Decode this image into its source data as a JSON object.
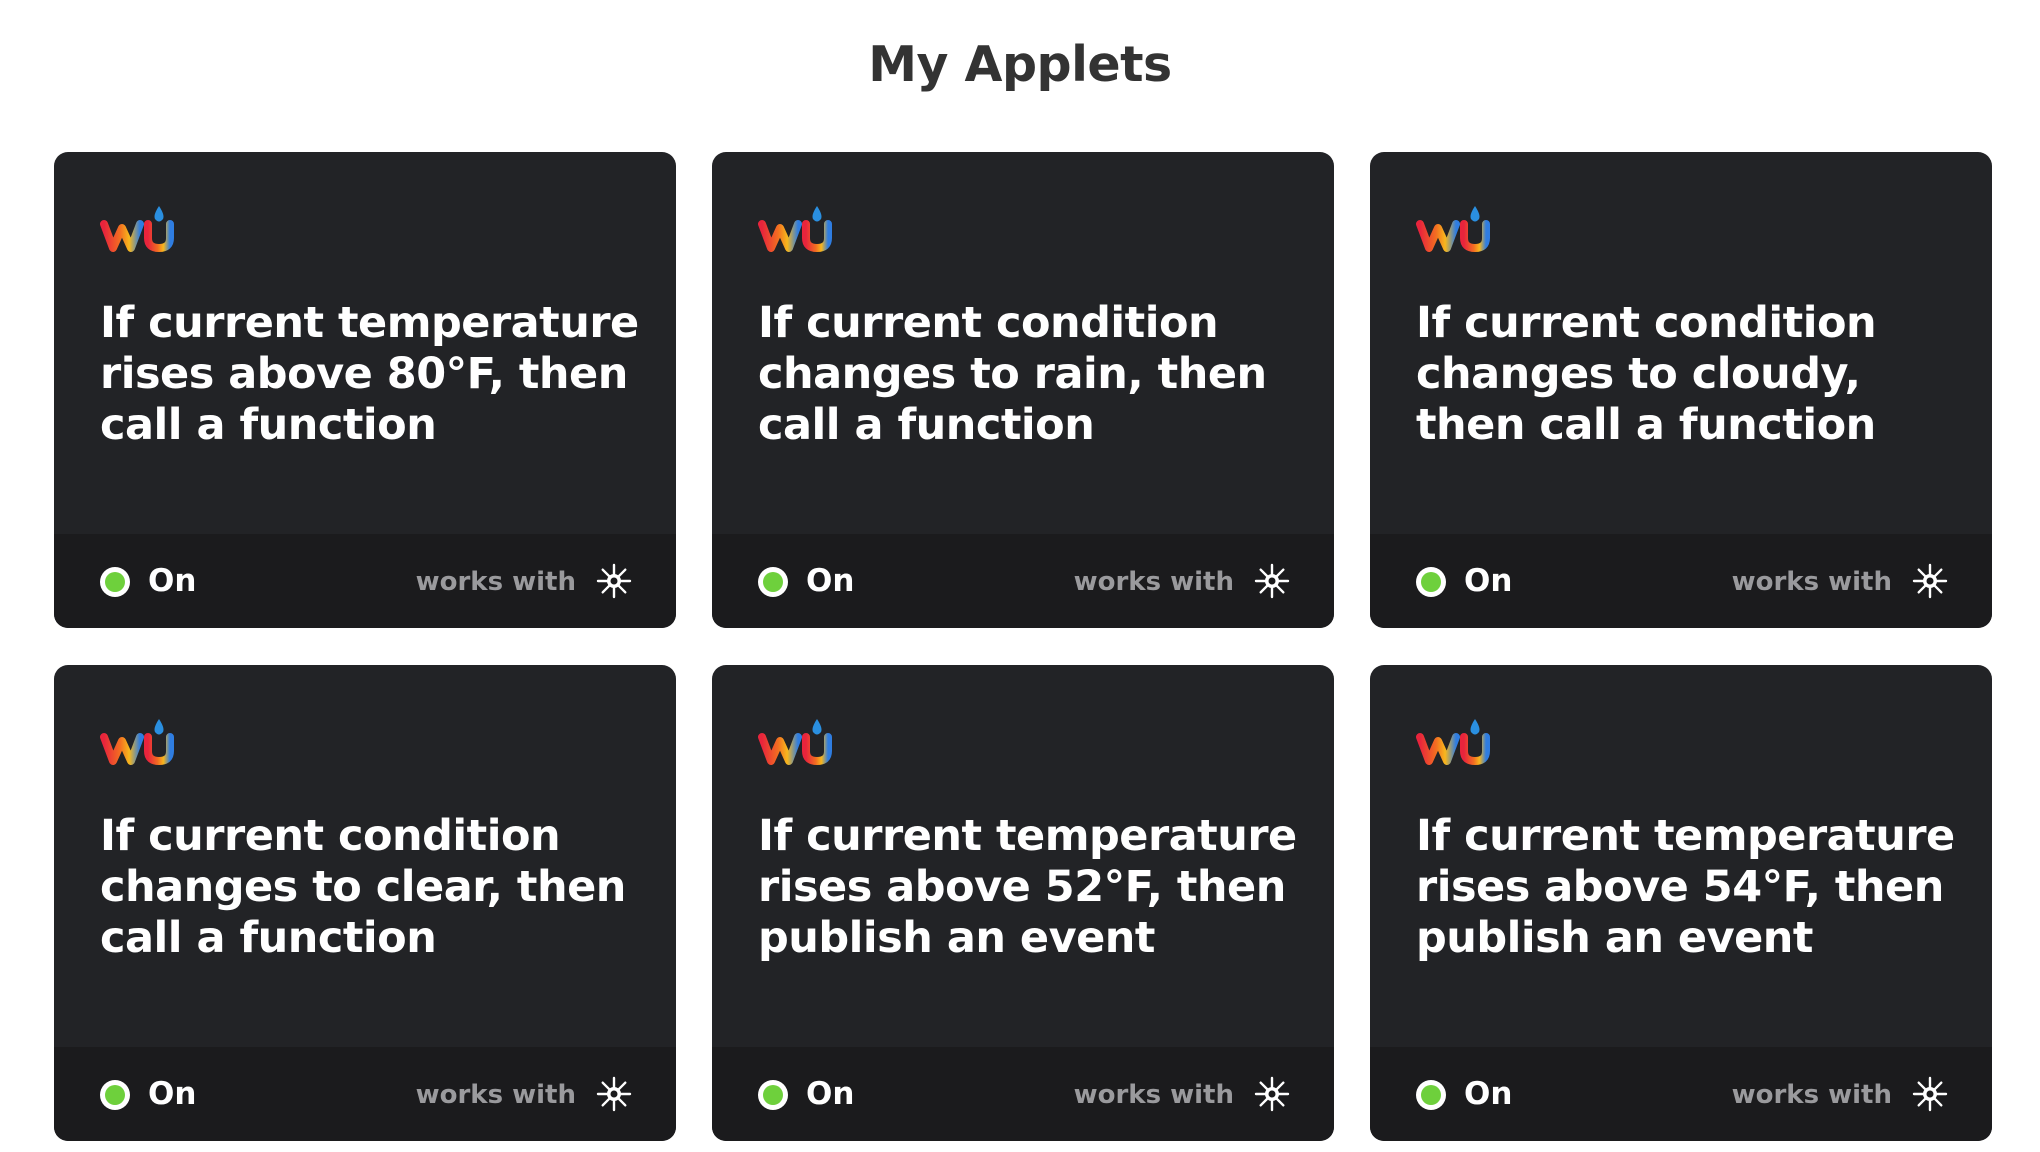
{
  "page": {
    "title": "My Applets"
  },
  "colors": {
    "card_background": "#222326",
    "footer_background": "#1b1b1d",
    "status_on": "#6ed03c",
    "muted_text": "#9a9a9d"
  },
  "icons": {
    "service_logo": "weather-underground-logo",
    "works_with": "particle-sparkle-icon"
  },
  "applets": [
    {
      "title": "If current temperature rises above 80°F, then call a function",
      "status": "On",
      "works_with_label": "works with"
    },
    {
      "title": "If current condition changes to rain, then call a function",
      "status": "On",
      "works_with_label": "works with"
    },
    {
      "title": "If current condition changes to cloudy, then call a function",
      "status": "On",
      "works_with_label": "works with"
    },
    {
      "title": "If current condition changes to clear, then call a function",
      "status": "On",
      "works_with_label": "works with"
    },
    {
      "title": "If current temperature rises above 52°F, then publish an event",
      "status": "On",
      "works_with_label": "works with"
    },
    {
      "title": "If current temperature rises above 54°F, then publish an event",
      "status": "On",
      "works_with_label": "works with"
    }
  ]
}
